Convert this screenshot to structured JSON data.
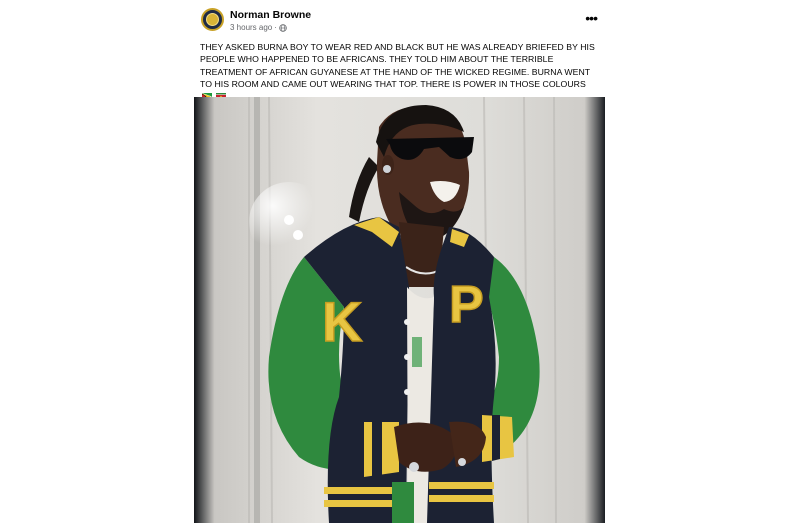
{
  "post": {
    "author": "Norman Browne",
    "time": "3 hours ago",
    "separator": "·",
    "text": "THEY ASKED BURNA BOY TO WEAR RED AND BLACK BUT HE WAS ALREADY BRIEFED BY HIS PEOPLE WHO HAPPENED TO BE AFRICANS. THEY TOLD HIM ABOUT THE TERRIBLE TREATMENT OF AFRICAN GUYANESE AT THE HAND OF THE WICKED REGIME. BURNA WENT TO HIS ROOM AND CAME OUT WEARING THAT TOP. THERE IS POWER IN THOSE COLOURS",
    "emoji_icons": [
      "guyana-flag-icon",
      "suriname-flag-icon"
    ],
    "more_icon": "more-horizontal-icon",
    "privacy_icon": "globe-icon"
  },
  "photo": {
    "jacket_letters": [
      "K",
      "P"
    ],
    "colors": {
      "jacket_body": "#1c2233",
      "sleeves": "#2f8a3e",
      "letters": "#e8c542",
      "stripes": "#e8c542"
    }
  }
}
